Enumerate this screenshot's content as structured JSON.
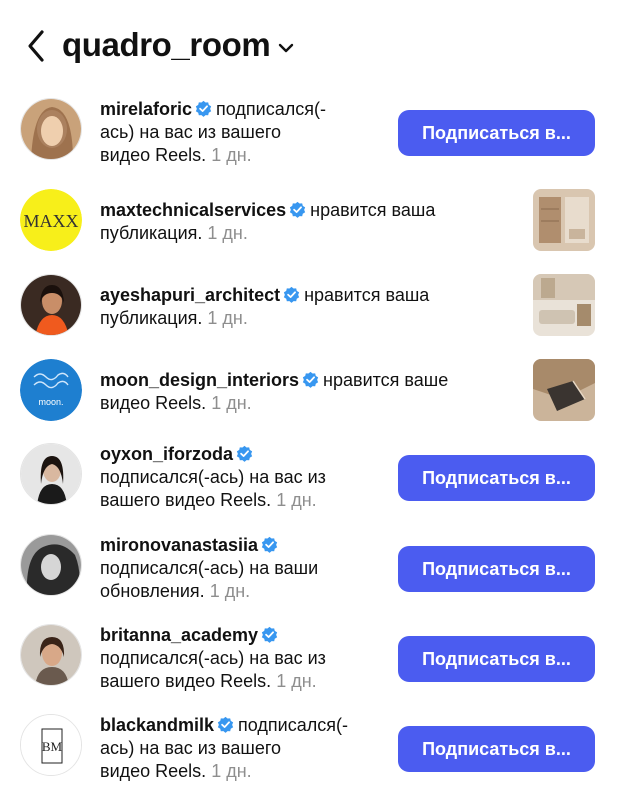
{
  "header": {
    "title": "quadro_room"
  },
  "colors": {
    "accent": "#4b5cf0",
    "verified": "#3897f0",
    "muted": "#8e8e8e"
  },
  "notifications": [
    {
      "username": "mirelaforic",
      "line1": "подписался(-",
      "line2": "ась) на вас из вашего",
      "line3": "видео Reels.",
      "time": "1 дн.",
      "button": "Подписаться в..."
    },
    {
      "username": "maxtechnicalservices",
      "line1": "нравится ваша",
      "line2": "публикация.",
      "time": "1 дн.",
      "avatar_text": "MAXX"
    },
    {
      "username": "ayeshapuri_architect",
      "line1": "нравится ваша",
      "line2": "публикация.",
      "time": "1 дн."
    },
    {
      "username": "moon_design_interiors",
      "line1": "нравится ваше",
      "line2": "видео Reels.",
      "time": "1 дн.",
      "avatar_text": "moon."
    },
    {
      "username": "oyxon_iforzoda",
      "line1": "подписался(-ась) на вас из",
      "line2": "вашего видео Reels.",
      "time": "1 дн.",
      "button": "Подписаться в..."
    },
    {
      "username": "mironovanastasiia",
      "line1": "подписался(-ась) на ваши",
      "line2": "обновления.",
      "time": "1 дн.",
      "button": "Подписаться в..."
    },
    {
      "username": "britanna_academy",
      "line1": "подписался(-ась) на вас из",
      "line2": "вашего видео Reels.",
      "time": "1 дн.",
      "button": "Подписаться в..."
    },
    {
      "username": "blackandmilk",
      "line1": "подписался(-",
      "line2": "ась) на вас из вашего",
      "line3": "видео Reels.",
      "time": "1 дн.",
      "button": "Подписаться в...",
      "avatar_text": "BM"
    }
  ]
}
